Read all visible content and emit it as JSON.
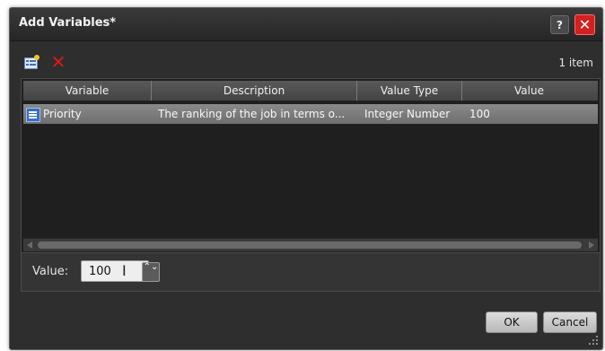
{
  "dialog": {
    "title": "Add Variables*",
    "help_glyph": "?",
    "close_glyph": "✕"
  },
  "toolbar": {
    "add_icon": "add-variable-icon",
    "delete_icon": "delete-icon",
    "delete_glyph": "✕",
    "item_count": "1 item"
  },
  "table": {
    "columns": [
      "Variable",
      "Description",
      "Value Type",
      "Value"
    ],
    "rows": [
      {
        "variable": "Priority",
        "description": "The ranking of the job in terms o...",
        "value_type": "Integer Number",
        "value": "100"
      }
    ]
  },
  "editor": {
    "value_label": "Value:",
    "value": "100",
    "spinner_glyph": "⌃⌄"
  },
  "buttons": {
    "ok": "OK",
    "cancel": "Cancel"
  },
  "colors": {
    "dialog_bg": "#2e2e2e",
    "close_red": "#d32020",
    "selected_row": "#7a7a7a"
  }
}
